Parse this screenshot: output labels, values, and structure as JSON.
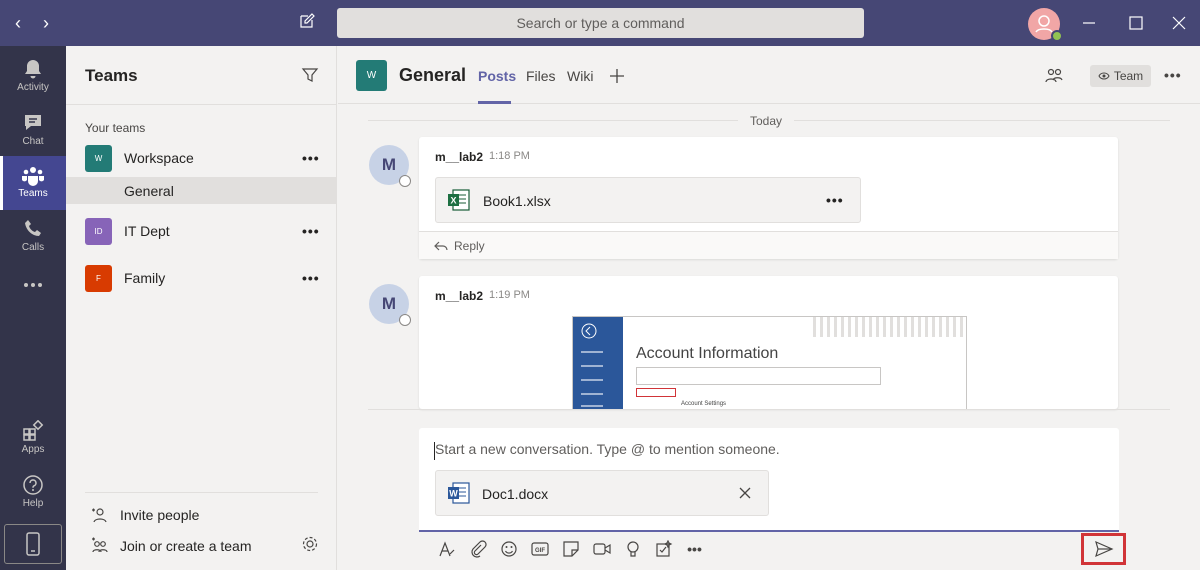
{
  "app": {
    "search_placeholder": "Search or type a command"
  },
  "rail": {
    "items": [
      {
        "label": "Activity",
        "icon": "bell-icon"
      },
      {
        "label": "Chat",
        "icon": "chat-icon"
      },
      {
        "label": "Teams",
        "icon": "teams-icon"
      },
      {
        "label": "Calls",
        "icon": "phone-icon"
      },
      {
        "label": "",
        "icon": "more-icon"
      },
      {
        "label": "Apps",
        "icon": "apps-icon"
      },
      {
        "label": "Help",
        "icon": "help-icon"
      }
    ],
    "active": "Teams"
  },
  "teams_panel": {
    "title": "Teams",
    "section_label": "Your teams",
    "teams": [
      {
        "name": "Workspace",
        "initials": "W",
        "color": "#237b76"
      },
      {
        "name": "IT Dept",
        "initials": "ID",
        "color": "#8764b8"
      },
      {
        "name": "Family",
        "initials": "F",
        "color": "#d83b01"
      }
    ],
    "selected_channel": "General",
    "more_label": "•••",
    "invite_label": "Invite people",
    "join_label": "Join or create a team"
  },
  "channel": {
    "initial": "W",
    "title": "General",
    "tabs": [
      "Posts",
      "Files",
      "Wiki"
    ],
    "active_tab": "Posts",
    "team_button": "Team",
    "more_label": "•••"
  },
  "feed": {
    "date_separator": "Today",
    "messages": [
      {
        "avatar": "M",
        "author": "m__lab2",
        "time": "1:18 PM",
        "attachment": "Book1.xlsx",
        "attachment_type": "excel",
        "reply_label": "Reply"
      },
      {
        "avatar": "M",
        "author": "m__lab2",
        "time": "1:19 PM",
        "image": {
          "title": "Account Information",
          "add_account": "Add Account",
          "settings": "Account Settings"
        }
      }
    ]
  },
  "compose": {
    "placeholder": "Start a new conversation. Type @ to mention someone.",
    "attachment": "Doc1.docx",
    "attachment_type": "word",
    "toolbar_icons": [
      "format-icon",
      "attach-icon",
      "emoji-icon",
      "gif-icon",
      "sticker-icon",
      "meet-icon",
      "praise-icon",
      "approvals-icon",
      "more-icon"
    ],
    "more_label": "•••",
    "gif_label": "GIF"
  },
  "colors": {
    "titlebar": "#464775",
    "rail": "#33344a",
    "accent": "#6264a7",
    "highlight_border": "#d13438"
  }
}
